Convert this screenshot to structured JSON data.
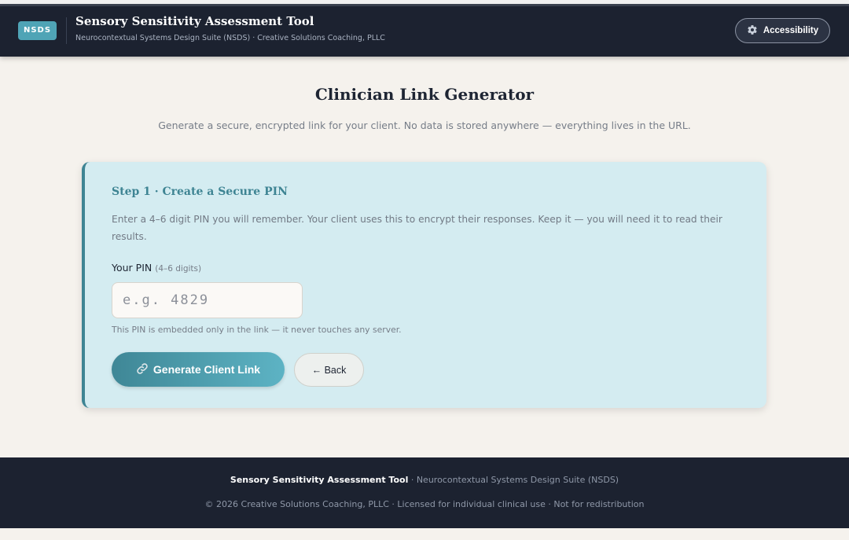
{
  "header": {
    "logo_text": "NSDS",
    "title": "Sensory Sensitivity Assessment Tool",
    "subtitle": "Neurocontextual Systems Design Suite (NSDS) · Creative Solutions Coaching, PLLC",
    "accessibility_label": "Accessibility",
    "accessibility_icon": "gear-icon"
  },
  "main": {
    "title": "Clinician Link Generator",
    "subtitle": "Generate a secure, encrypted link for your client. No data is stored anywhere — everything lives in the URL."
  },
  "step": {
    "title": "Step 1 · Create a Secure PIN",
    "description": "Enter a 4–6 digit PIN you will remember. Your client uses this to encrypt their responses. Keep it — you will need it to read their results.",
    "pin_label": "Your PIN",
    "pin_hint": "(4–6 digits)",
    "pin_placeholder": "e.g. 4829",
    "pin_value": "",
    "pin_note": "This PIN is embedded only in the link — it never touches any server.",
    "generate_label": "Generate Client Link",
    "generate_icon": "link-icon",
    "back_label": "← Back"
  },
  "footer": {
    "tool_name": "Sensory Sensitivity Assessment Tool",
    "suite": " · Neurocontextual Systems Design Suite (NSDS)",
    "copyright": "© 2026 Creative Solutions Coaching, PLLC · Licensed for individual clinical use · Not for redistribution"
  },
  "colors": {
    "accent": "#3e8493",
    "header_bg": "#1c2230",
    "card_bg": "#d4ecf1",
    "page_bg": "#f5f2ed"
  }
}
